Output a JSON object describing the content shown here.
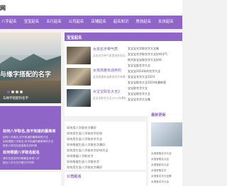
{
  "site": {
    "title": "网"
  },
  "nav": {
    "items": [
      {
        "label": "八字起名"
      },
      {
        "label": "宝宝起名"
      },
      {
        "label": "五行起名"
      },
      {
        "label": "公司起名"
      },
      {
        "label": "店铺起名"
      },
      {
        "label": "起名知识"
      },
      {
        "label": "男孩起名"
      },
      {
        "label": "女孩起名"
      }
    ]
  },
  "banner": {
    "headline": "与缘字搭配的名字",
    "caption": "与缘字搭配的名字"
  },
  "panel": {
    "title": "宝宝起名",
    "articles": [
      {
        "title": "女孩名字带气质",
        "summary": "女孩名字带气质是很多家长所追求的"
      },
      {
        "title": "女孩高雅有涵养的",
        "summary": "女孩高雅有涵养的名字有哪些"
      },
      {
        "title": "女宝宝取名大全2",
        "summary": "女宝宝取名大全2024年最新版"
      }
    ],
    "side_list": [
      "女宝宝名字取名字大全集",
      "女宝宝名字取名字大全好听洋气",
      "姓刘女宝宝取名字大全好听",
      "女宝宝起名字大全",
      "女宝宝2024年的名字大全",
      "女宝宝名字大全2023",
      "女宝宝取名大全2024年最新版",
      "宝宝取名字大全",
      "女宝宝取名字大全",
      "女宝宝名字大全集"
    ]
  },
  "left_block": {
    "title": "如何八字取名,你不知道的最简单",
    "text1": "如何八字取名,你不知道的最简单的方法",
    "text2": "如何根据八字取名,你不知道的最简单的方法",
    "text3": "很多父母在给宝宝取名的时候",
    "title2": "如何根据八字取名起名",
    "text4": "我们在起名的时候都会考虑八字",
    "text5": "因为八字与五行是分不开的"
  },
  "mid_list": {
    "items": [
      "如何用八字取名字最好",
      "如何用生辰八字取名字好听",
      "如何用生辰八字取名字大全",
      "如何根据生辰八字取名字最好",
      "如何用生辰八字取名字好听大全",
      "如何根据八字取名字",
      "如何根据生辰八字取名字",
      "如何用生辰八字取名字最好"
    ]
  },
  "right_panel": {
    "title": "最新更新",
    "items": [
      "女宝宝取名字大全",
      "女宝宝取名大全",
      "女宝宝起名大全",
      "女宝宝取名字",
      "女宝宝名字大全集",
      "女宝宝名字大全"
    ]
  },
  "bottom": {
    "mid_title": "公司起名"
  }
}
